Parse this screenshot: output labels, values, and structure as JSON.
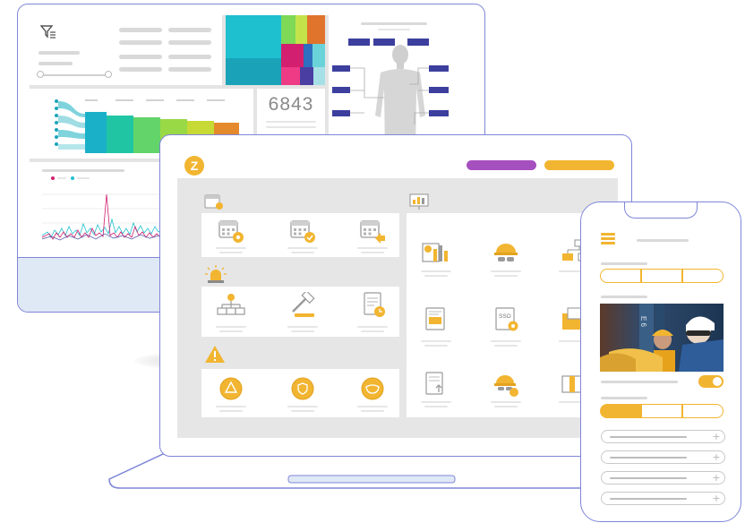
{
  "monitor": {
    "kpi_value": "6843"
  },
  "laptop": {
    "logo_letter": "Z",
    "header_buttons": [
      {
        "color": "#a64fbf"
      },
      {
        "color": "#f2b531"
      }
    ],
    "sections": [
      {
        "header_icon": "calendar-icon",
        "items": [
          "calendar-settings-icon",
          "calendar-check-icon",
          "calendar-share-icon"
        ]
      },
      {
        "header_icon": "alarm-light-icon",
        "items": [
          "org-chart-icon",
          "gavel-icon",
          "document-clock-icon"
        ]
      },
      {
        "header_icon": "warning-icon",
        "items": [
          "hazard-circle-icon",
          "shield-circle-icon",
          "mask-circle-icon"
        ]
      }
    ],
    "right_grid": {
      "header_icon": "presentation-chart-icon",
      "sso_label": "SSO",
      "items": [
        "chart-person-icon",
        "hardhat-goggles-icon",
        "hierarchy-icon",
        "certificate-icon",
        "sso-settings-icon",
        "folder-icon",
        "document-upload-icon",
        "hardhat-people-icon",
        "box-icon"
      ]
    }
  },
  "phone": {
    "toggle_on": true,
    "photo_label": "E 6",
    "accordion_items": [
      {
        "icon": "plus-icon"
      },
      {
        "icon": "plus-icon"
      },
      {
        "icon": "plus-icon"
      },
      {
        "icon": "plus-icon"
      }
    ]
  },
  "colors": {
    "accent": "#f2b531",
    "outline": "#7f86d8",
    "purple": "#a64fbf"
  }
}
